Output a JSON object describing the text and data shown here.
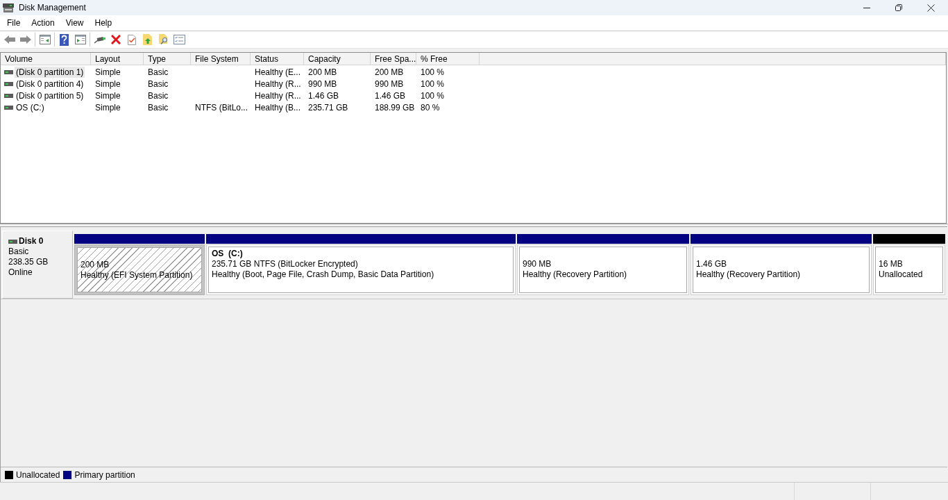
{
  "window": {
    "title": "Disk Management"
  },
  "menu": [
    "File",
    "Action",
    "View",
    "Help"
  ],
  "volume_list": {
    "columns": [
      "Volume",
      "Layout",
      "Type",
      "File System",
      "Status",
      "Capacity",
      "Free Spa...",
      "% Free"
    ],
    "rows": [
      {
        "selected": true,
        "volume": "(Disk 0 partition 1)",
        "layout": "Simple",
        "type": "Basic",
        "status": "Healthy (E...",
        "capacity": "200 MB",
        "free_space": "200 MB",
        "percent_free": "100 %"
      },
      {
        "selected": false,
        "volume": "(Disk 0 partition 4)",
        "layout": "Simple",
        "type": "Basic",
        "status": "Healthy (R...",
        "capacity": "990 MB",
        "free_space": "990 MB",
        "percent_free": "100 %"
      },
      {
        "selected": false,
        "volume": "(Disk 0 partition 5)",
        "layout": "Simple",
        "type": "Basic",
        "status": "Healthy (R...",
        "capacity": "1.46 GB",
        "free_space": "1.46 GB",
        "percent_free": "100 %"
      },
      {
        "selected": false,
        "volume": "OS (C:)",
        "layout": "Simple",
        "type": "Basic",
        "file_system": "NTFS (BitLo...",
        "status": "Healthy (B...",
        "capacity": "235.71 GB",
        "free_space": "188.99 GB",
        "percent_free": "80 %"
      }
    ]
  },
  "disk": {
    "name": "Disk 0",
    "type": "Basic",
    "size": "238.35 GB",
    "status": "Online",
    "partitions": [
      {
        "kind": "primary",
        "selected": true,
        "size": "200 MB",
        "status": "Healthy (EFI System Partition)"
      },
      {
        "kind": "primary",
        "selected": false,
        "name": "OS  (C:)",
        "size": "235.71 GB NTFS (BitLocker Encrypted)",
        "status": "Healthy (Boot, Page File, Crash Dump, Basic Data Partition)"
      },
      {
        "kind": "primary",
        "selected": false,
        "size": "990 MB",
        "status": "Healthy (Recovery Partition)"
      },
      {
        "kind": "primary",
        "selected": false,
        "size": "1.46 GB",
        "status": "Healthy (Recovery Partition)"
      },
      {
        "kind": "unallocated",
        "selected": false,
        "size": "16 MB",
        "status": "Unallocated"
      }
    ]
  },
  "legend": [
    {
      "label": "Unallocated",
      "color": "#000000"
    },
    {
      "label": "Primary partition",
      "color": "#000080"
    }
  ]
}
